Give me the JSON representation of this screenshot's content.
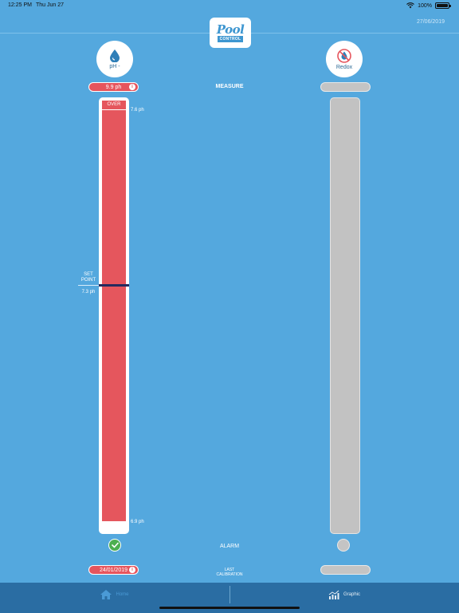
{
  "status_bar": {
    "time": "12:25 PM",
    "date": "Thu Jun 27",
    "battery": "100%",
    "battery_level": 1.0
  },
  "header": {
    "date": "27/06/2019",
    "logo_word": "Pool",
    "logo_sub": "CONTROL"
  },
  "sensors": {
    "ph": {
      "label": "pH -",
      "measure": "9.9 ph",
      "top_tick": "7.6 ph",
      "bottom_tick": "6.9 ph",
      "status": "OVER",
      "setpoint_label_1": "SET",
      "setpoint_label_2": "POINT",
      "setpoint_value": "7.3 ph",
      "calibration_date": "24/01/2019"
    },
    "redox": {
      "label": "Redox"
    }
  },
  "center": {
    "measure_label": "MEASURE",
    "alarm_label": "ALARM",
    "last_calibration_1": "LAST",
    "last_calibration_2": "CALIBRATION"
  },
  "tabs": [
    {
      "label": "Home",
      "icon": "home-icon",
      "selected": true
    },
    {
      "label": "Graphic",
      "icon": "graphic-icon",
      "selected": false
    }
  ],
  "colors": {
    "background": "#54a8de",
    "alert": "#e6555d",
    "ok": "#4caf50",
    "inactive": "#c4c4c4",
    "tabbar": "#2a6da3"
  }
}
